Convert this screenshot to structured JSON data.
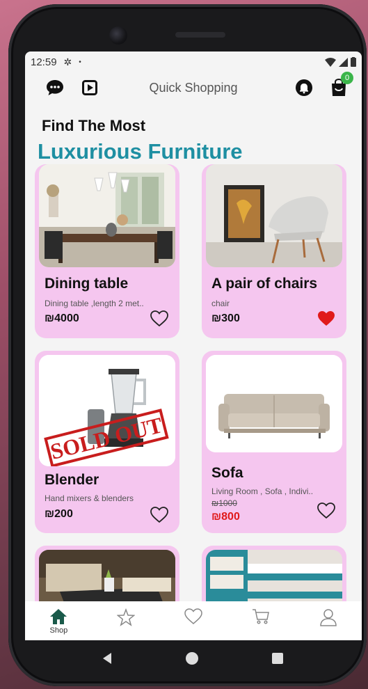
{
  "status_bar": {
    "time": "12:59"
  },
  "app_bar": {
    "title": "Quick Shopping",
    "cart_count": "0"
  },
  "heading": {
    "line1": "Find The Most",
    "line2": "Luxurious Furniture"
  },
  "products": [
    {
      "name": "Dining table",
      "description": "Dining table ,length 2 met..",
      "price": "₪4000",
      "favorited": false
    },
    {
      "name": "A pair of chairs",
      "description": "chair",
      "price": "₪300",
      "favorited": true
    },
    {
      "name": "Blender",
      "description": "Hand mixers & blenders",
      "price": "₪200",
      "favorited": false,
      "sold_out_label": "SOLD OUT"
    },
    {
      "name": "Sofa",
      "description": "Living Room , Sofa , Indivi..",
      "old_price": "₪1000",
      "price": "₪800",
      "favorited": false
    }
  ],
  "bottom_nav": [
    {
      "label": "Shop",
      "icon": "home-icon",
      "active": true
    },
    {
      "label": "",
      "icon": "star-icon"
    },
    {
      "label": "",
      "icon": "heart-icon"
    },
    {
      "label": "",
      "icon": "cart-icon"
    },
    {
      "label": "",
      "icon": "person-icon"
    }
  ],
  "colors": {
    "accent": "#1e8fa2",
    "card": "#f5c6ef",
    "sale": "#e01a1a",
    "badge": "#3bb54a"
  }
}
